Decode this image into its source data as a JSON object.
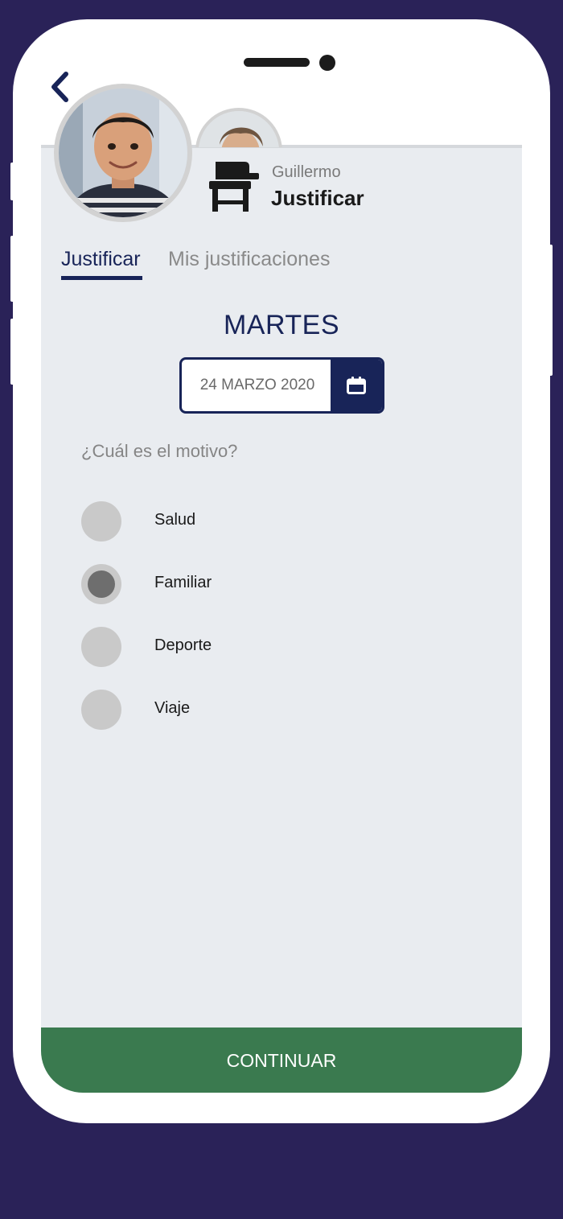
{
  "header": {
    "student_name": "Guillermo",
    "title": "Justificar"
  },
  "tabs": [
    {
      "label": "Justificar",
      "active": true
    },
    {
      "label": "Mis justificaciones",
      "active": false
    }
  ],
  "date": {
    "day": "MARTES",
    "value": "24 MARZO 2020"
  },
  "reason": {
    "question": "¿Cuál es el motivo?",
    "options": [
      {
        "label": "Salud",
        "selected": false
      },
      {
        "label": "Familiar",
        "selected": true
      },
      {
        "label": "Deporte",
        "selected": false
      },
      {
        "label": "Viaje",
        "selected": false
      }
    ]
  },
  "actions": {
    "continue_label": "CONTINUAR"
  },
  "icons": {
    "back": "chevron-left-icon",
    "desk": "school-desk-icon",
    "calendar": "calendar-icon"
  },
  "colors": {
    "background": "#2a2258",
    "primary": "#182458",
    "accent_green": "#3a7a4f",
    "screen_bg": "#e9ecf0"
  }
}
